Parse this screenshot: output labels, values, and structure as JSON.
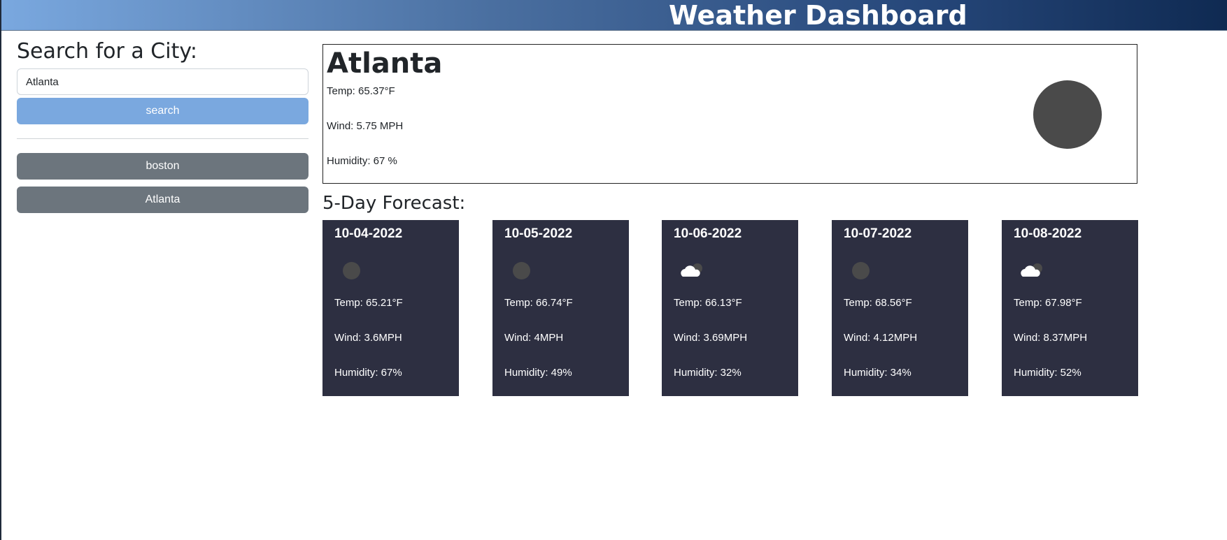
{
  "header": {
    "title": "Weather Dashboard"
  },
  "sidebar": {
    "heading": "Search for a City:",
    "input_value": "Atlanta",
    "search_label": "search",
    "history": [
      "boston",
      "Atlanta"
    ]
  },
  "current": {
    "city": "Atlanta",
    "temp": "Temp: 65.37°F",
    "wind": "Wind: 5.75 MPH",
    "humidity": "Humidity: 67 %",
    "icon": "placeholder-circle-icon"
  },
  "forecast": {
    "title": "5-Day Forecast:",
    "days": [
      {
        "date": "10-04-2022",
        "icon": "placeholder-circle-icon",
        "temp": "Temp: 65.21°F",
        "wind": "Wind: 3.6MPH",
        "humidity": "Humidity: 67%"
      },
      {
        "date": "10-05-2022",
        "icon": "placeholder-circle-icon",
        "temp": "Temp: 66.74°F",
        "wind": "Wind: 4MPH",
        "humidity": "Humidity: 49%"
      },
      {
        "date": "10-06-2022",
        "icon": "cloud-icon",
        "temp": "Temp: 66.13°F",
        "wind": "Wind: 3.69MPH",
        "humidity": "Humidity: 32%"
      },
      {
        "date": "10-07-2022",
        "icon": "placeholder-circle-icon",
        "temp": "Temp: 68.56°F",
        "wind": "Wind: 4.12MPH",
        "humidity": "Humidity: 34%"
      },
      {
        "date": "10-08-2022",
        "icon": "cloud-icon",
        "temp": "Temp: 67.98°F",
        "wind": "Wind: 8.37MPH",
        "humidity": "Humidity: 52%"
      }
    ]
  },
  "colors": {
    "header_start": "#7aa8df",
    "header_end": "#0f2a52",
    "search_button": "#7aa8df",
    "history_button": "#6c757d",
    "forecast_card": "#2d2f41"
  }
}
